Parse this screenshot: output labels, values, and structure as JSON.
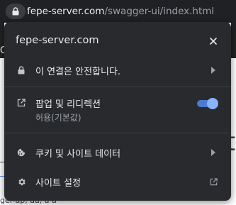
{
  "toolbar": {
    "url_host": "fepe-server.com",
    "url_path": "/swagger-ui/index.html"
  },
  "background": {
    "partial_letter": "C",
    "big_letter": "t",
    "bottom_text": "ger-ap, aa, a a"
  },
  "popup": {
    "title": "fepe-server.com",
    "connection_label": "이 연결은 안전합니다.",
    "popup_redirect_label": "팝업 및 리디렉션",
    "popup_redirect_sub": "허용(기본값)",
    "popup_redirect_enabled": true,
    "cookies_label": "쿠키 및 사이트 데이터",
    "site_settings_label": "사이트 설정"
  },
  "colors": {
    "popup_bg": "#292a2d",
    "toggle_on": "#8ab4f8",
    "text": "#e8eaed",
    "subtext": "#9aa0a6"
  }
}
